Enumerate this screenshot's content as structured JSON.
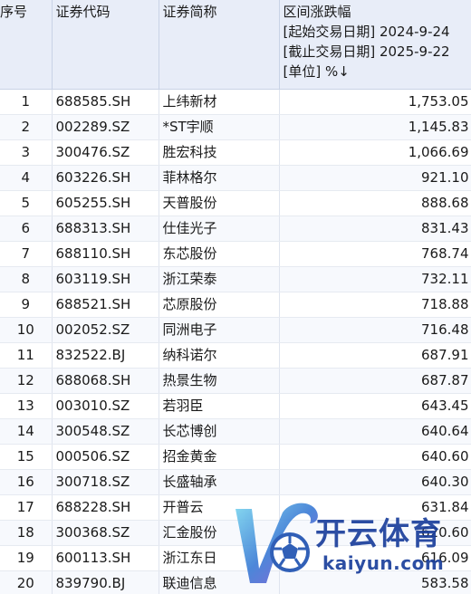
{
  "header": {
    "col_index": "序号",
    "col_code": "证券代码",
    "col_name": "证券简称",
    "col_change": "区间涨跌幅",
    "start_date": "[起始交易日期] 2024-9-24",
    "end_date": "[截止交易日期] 2025-9-22",
    "unit": "[单位] %↓"
  },
  "rows": [
    {
      "idx": "1",
      "code": "688585.SH",
      "name": "上纬新材",
      "value": "1,753.05"
    },
    {
      "idx": "2",
      "code": "002289.SZ",
      "name": "*ST宇顺",
      "value": "1,145.83"
    },
    {
      "idx": "3",
      "code": "300476.SZ",
      "name": "胜宏科技",
      "value": "1,066.69"
    },
    {
      "idx": "4",
      "code": "603226.SH",
      "name": "菲林格尔",
      "value": "921.10"
    },
    {
      "idx": "5",
      "code": "605255.SH",
      "name": "天普股份",
      "value": "888.68"
    },
    {
      "idx": "6",
      "code": "688313.SH",
      "name": "仕佳光子",
      "value": "831.43"
    },
    {
      "idx": "7",
      "code": "688110.SH",
      "name": "东芯股份",
      "value": "768.74"
    },
    {
      "idx": "8",
      "code": "603119.SH",
      "name": "浙江荣泰",
      "value": "732.11"
    },
    {
      "idx": "9",
      "code": "688521.SH",
      "name": "芯原股份",
      "value": "718.88"
    },
    {
      "idx": "10",
      "code": "002052.SZ",
      "name": "同洲电子",
      "value": "716.48"
    },
    {
      "idx": "11",
      "code": "832522.BJ",
      "name": "纳科诺尔",
      "value": "687.91"
    },
    {
      "idx": "12",
      "code": "688068.SH",
      "name": "热景生物",
      "value": "687.87"
    },
    {
      "idx": "13",
      "code": "003010.SZ",
      "name": "若羽臣",
      "value": "643.45"
    },
    {
      "idx": "14",
      "code": "300548.SZ",
      "name": "长芯博创",
      "value": "640.64"
    },
    {
      "idx": "15",
      "code": "000506.SZ",
      "name": "招金黄金",
      "value": "640.60"
    },
    {
      "idx": "16",
      "code": "300718.SZ",
      "name": "长盛轴承",
      "value": "640.30"
    },
    {
      "idx": "17",
      "code": "688228.SH",
      "name": "开普云",
      "value": "631.84"
    },
    {
      "idx": "18",
      "code": "300368.SZ",
      "name": "汇金股份",
      "value": "620.60"
    },
    {
      "idx": "19",
      "code": "600113.SH",
      "name": "浙江东日",
      "value": "616.09"
    },
    {
      "idx": "20",
      "code": "839790.BJ",
      "name": "联迪信息",
      "value": "583.58"
    }
  ],
  "watermark": {
    "text_cn": "开云体育",
    "text_en": "kaiyun.com",
    "logo_icon": "kaiyun-football-logo",
    "color": "#1b3f9c"
  }
}
